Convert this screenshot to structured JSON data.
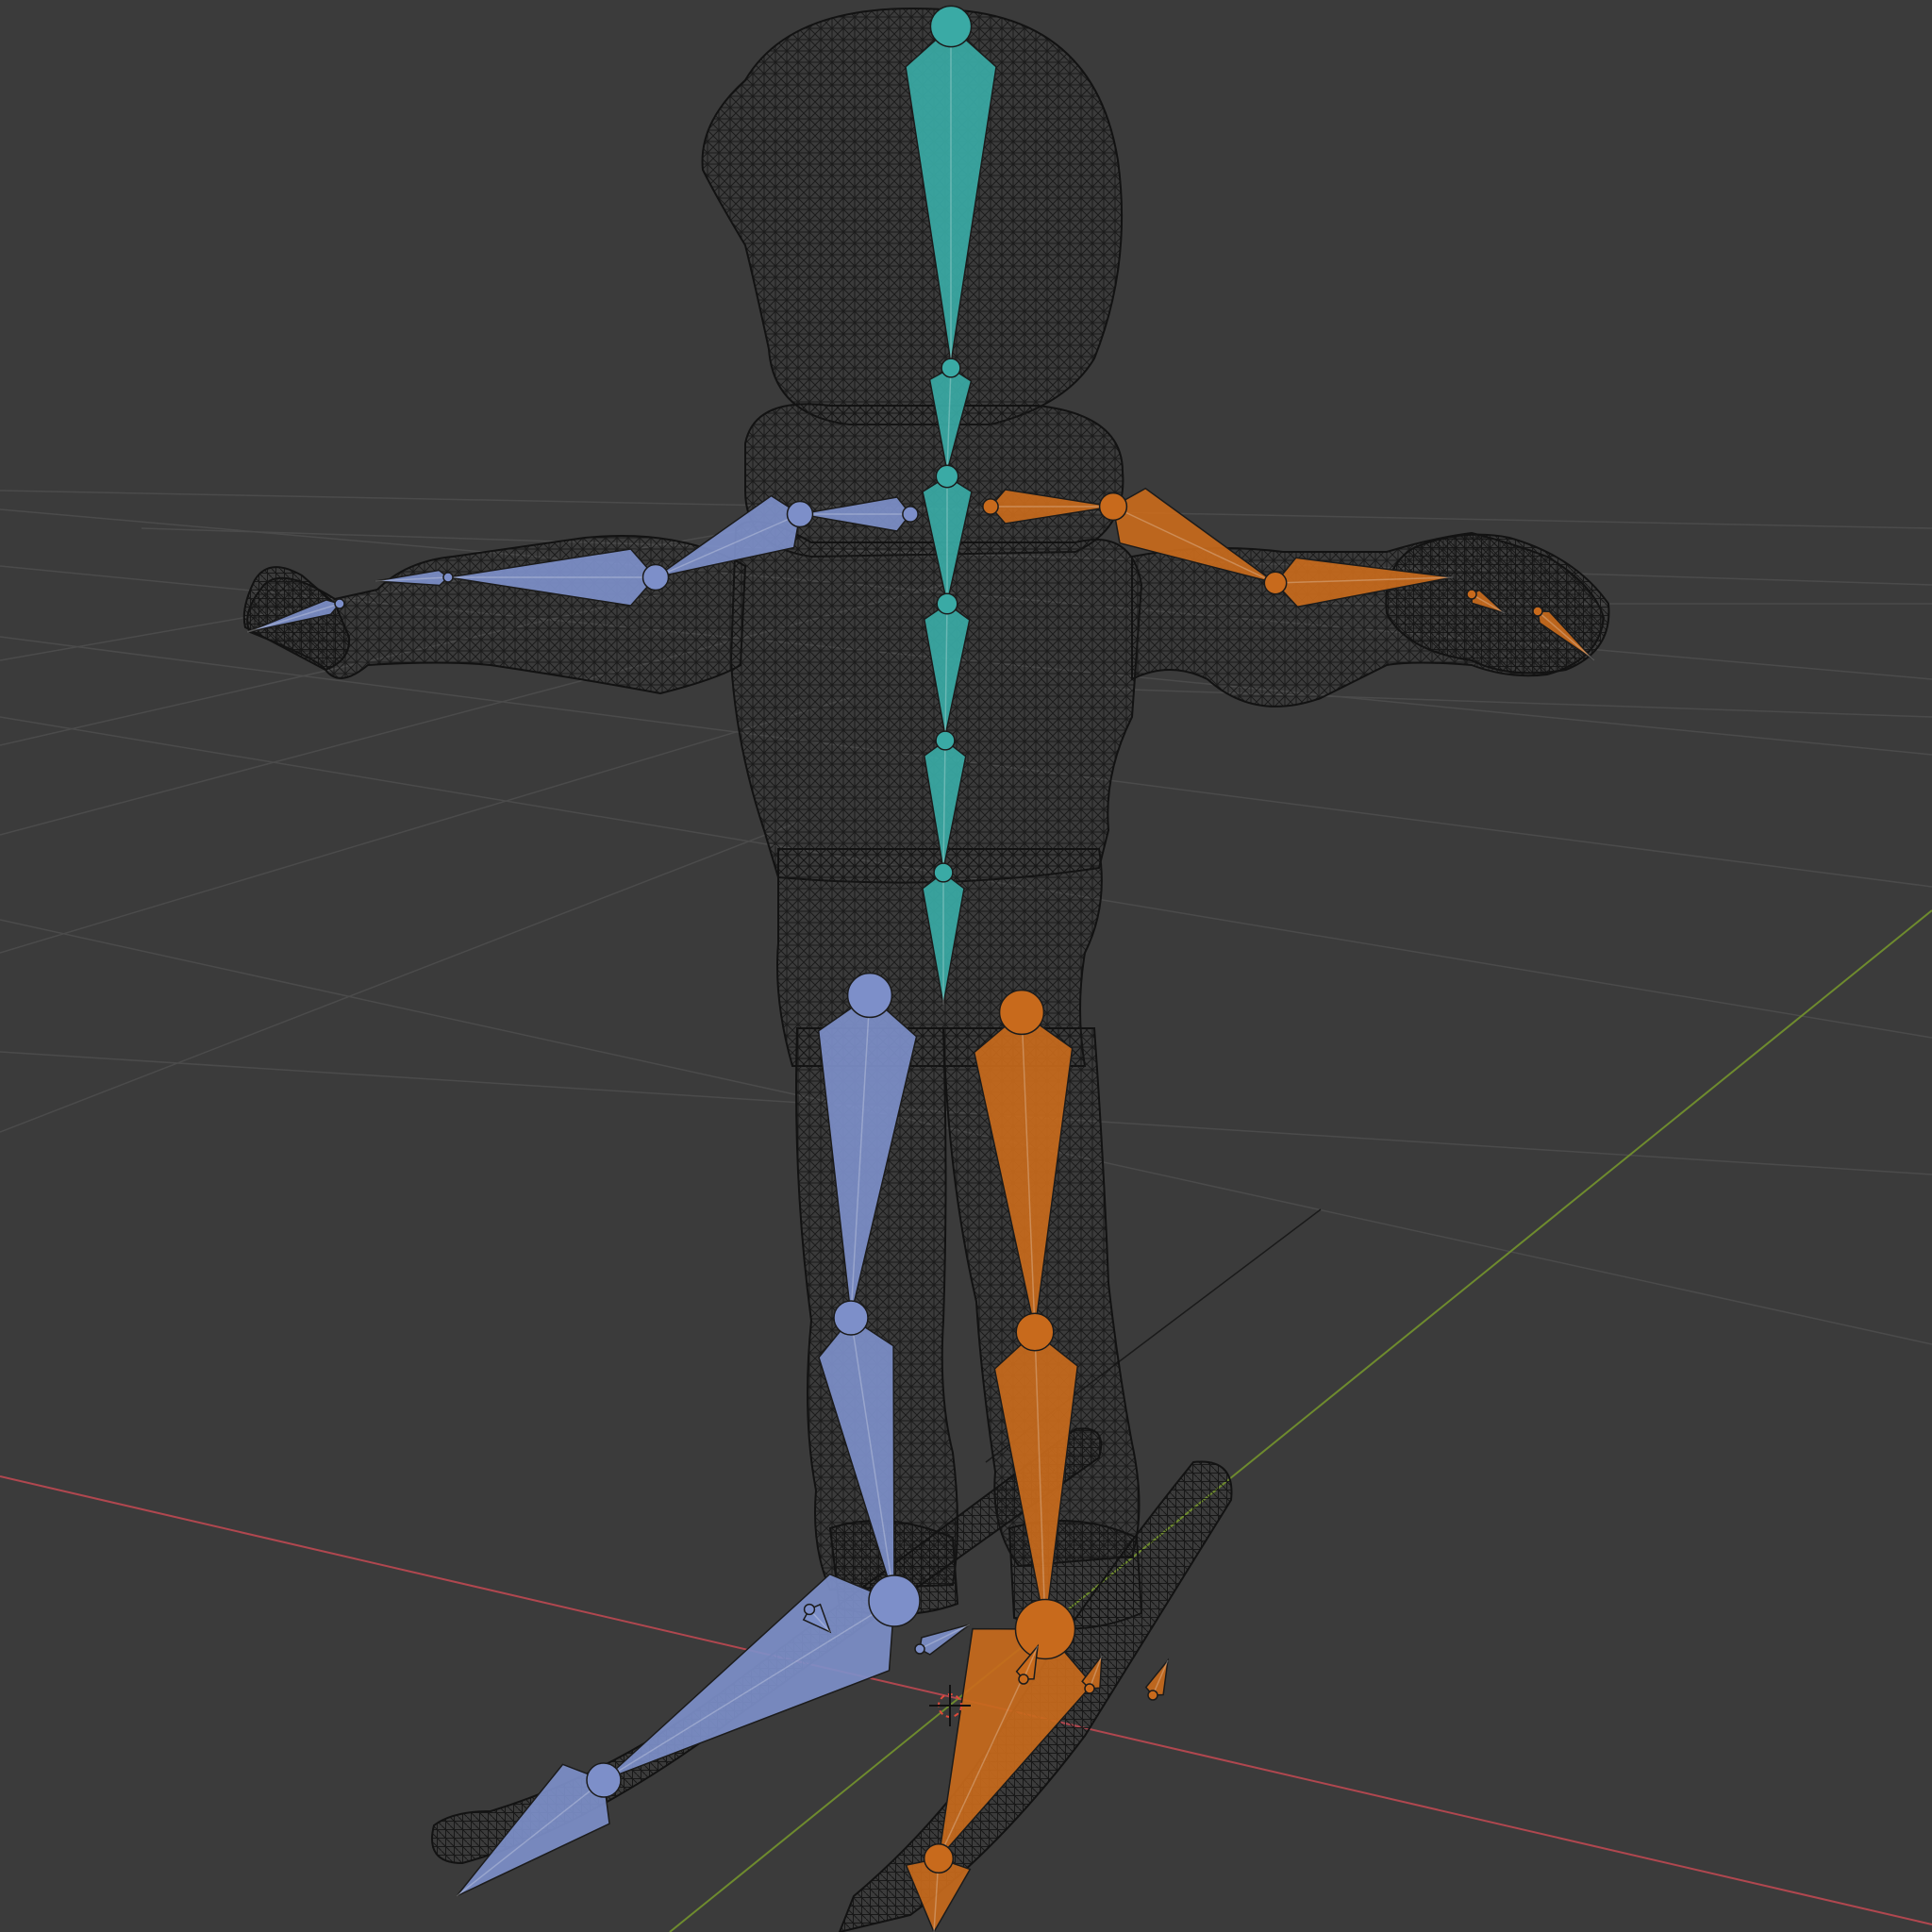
{
  "viewport": {
    "mode": "3D Viewport",
    "shading": "wireframe",
    "background": "#3b3b3b"
  },
  "colors": {
    "grid": "#4a4a4a",
    "x_axis": "#b0474f",
    "y_axis": "#6e8b2e",
    "wire": "#111111",
    "bones_center": "#3aaaa5",
    "bones_left": "#7d8fc9",
    "bones_right": "#c86a1c"
  },
  "objects": [
    {
      "name": "character-mesh",
      "type": "mesh",
      "display": "wireframe"
    },
    {
      "name": "armature",
      "type": "armature",
      "display": "octahedral"
    },
    {
      "name": "ski-left",
      "type": "mesh",
      "display": "wireframe"
    },
    {
      "name": "ski-right",
      "type": "mesh",
      "display": "wireframe"
    },
    {
      "name": "3d-cursor",
      "type": "cursor"
    }
  ],
  "bones": {
    "spine": [
      "head",
      "neck",
      "chest",
      "spine-2",
      "spine-1",
      "hips"
    ],
    "left": [
      "shoulder",
      "upper-arm",
      "forearm",
      "hand",
      "thigh",
      "shin",
      "foot",
      "toe"
    ],
    "right": [
      "shoulder",
      "upper-arm",
      "forearm",
      "hand",
      "thigh",
      "shin",
      "foot",
      "toe"
    ]
  }
}
